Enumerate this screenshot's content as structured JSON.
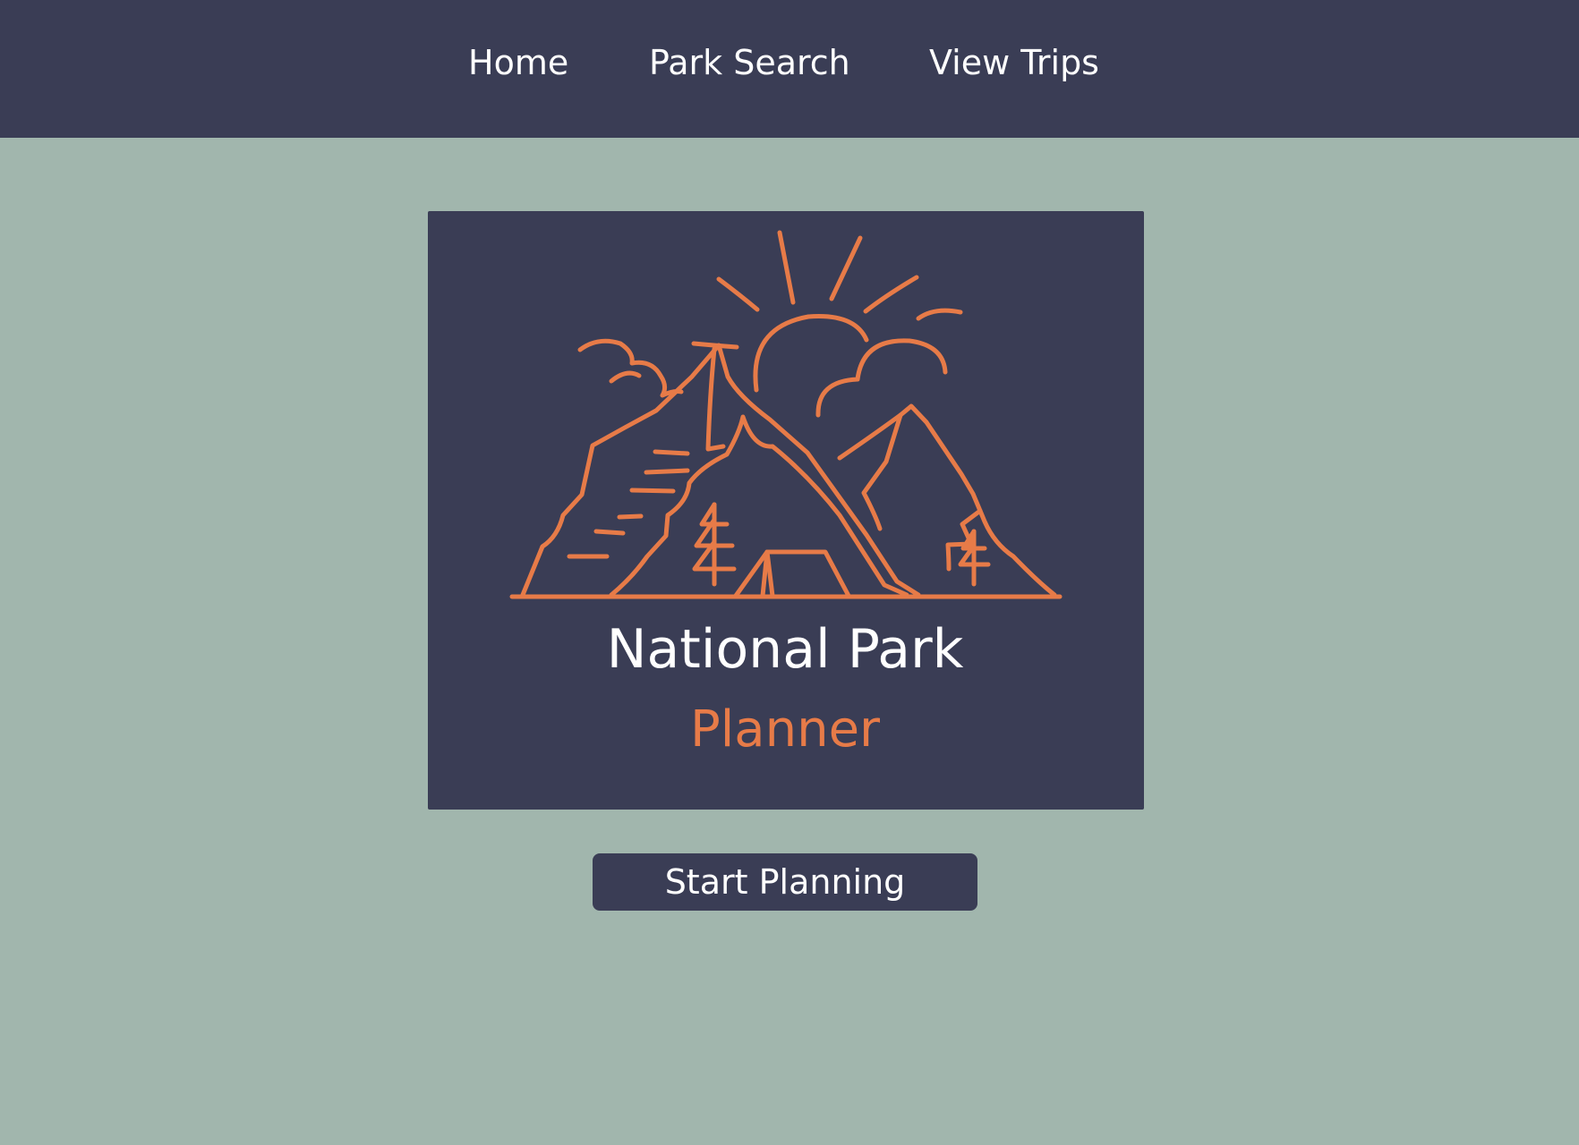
{
  "nav": {
    "items": [
      {
        "label": "Home"
      },
      {
        "label": "Park Search"
      },
      {
        "label": "View Trips"
      }
    ]
  },
  "logo": {
    "icon": "mountain-camp-sun-icon",
    "title": "National Park",
    "subtitle": "Planner"
  },
  "main": {
    "cta_label": "Start Planning"
  },
  "colors": {
    "background": "#a1b6ad",
    "navy": "#3a3d55",
    "accent": "#e77b48",
    "text": "#ffffff"
  }
}
